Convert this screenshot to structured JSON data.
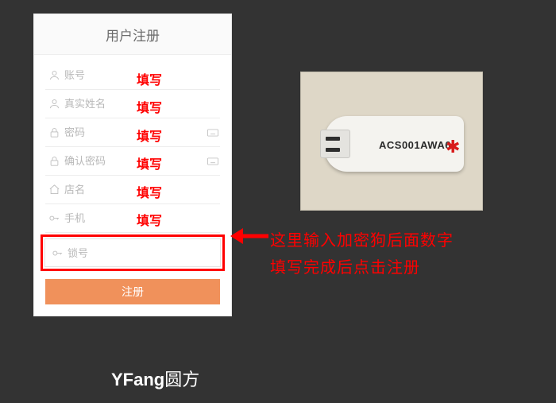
{
  "panel": {
    "title": "用户注册",
    "fields": {
      "account": {
        "placeholder": "账号",
        "annot": "填写"
      },
      "realname": {
        "placeholder": "真实姓名",
        "annot": "填写"
      },
      "password": {
        "placeholder": "密码",
        "annot": "填写"
      },
      "confirm": {
        "placeholder": "确认密码",
        "annot": "填写"
      },
      "store": {
        "placeholder": "店名",
        "annot": "填写"
      },
      "phone": {
        "placeholder": "手机",
        "annot": "填写"
      },
      "lock": {
        "placeholder": "锁号"
      }
    },
    "submit": "注册"
  },
  "dongle": {
    "label": "ACS001AWA6"
  },
  "notes": {
    "line1": "这里输入加密狗后面数字",
    "line2": "填写完成后点击注册"
  },
  "brand": {
    "en": "YFang",
    "cn": "圆方"
  }
}
